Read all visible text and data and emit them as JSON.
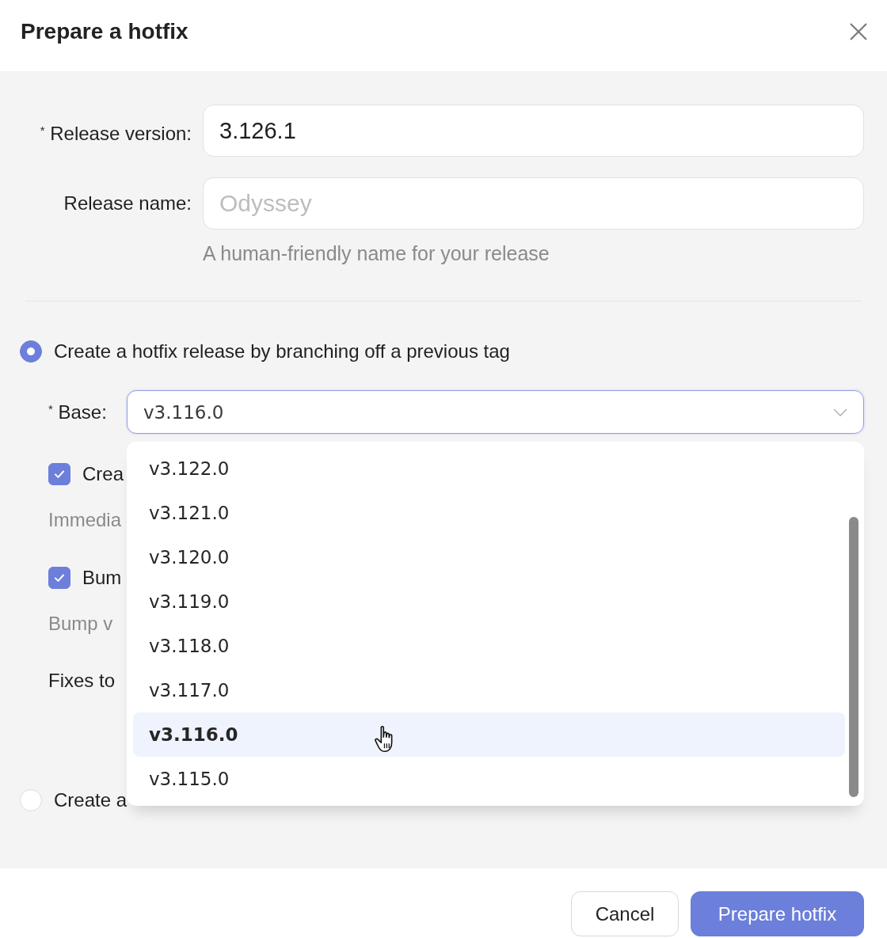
{
  "dialog": {
    "title": "Prepare a hotfix"
  },
  "fields": [
    {
      "label": "$^{*}$ Release version:",
      "value": "3.126.1"
    },
    {
      "label": "Release name:",
      "placeholder": "Odyssey",
      "help": "A human-friendly name for your release"
    }
  ],
  "modes": [
    {
      "label": "Create a hotfix release by branching off a previous tag",
      "selected": true,
      "base": {
        "label": "$^{*}$ Base:",
        "value": "v3.116.0",
        "expanded": true,
        "options": [
          {
            "label": "v3.122.0",
            "selected": false
          },
          {
            "label": "v3.121.0",
            "selected": false
          },
          {
            "label": "v3.120.0",
            "selected": false
          },
          {
            "label": "v3.119.0",
            "selected": false
          },
          {
            "label": "v3.118.0",
            "selected": false
          },
          {
            "label": "v3.117.0",
            "selected": false
          },
          {
            "label": "v3.116.0",
            "selected": true
          },
          {
            "label": "v3.115.0",
            "selected": false
          }
        ]
      },
      "settings": [
        {
          "kind": "checkbox",
          "label": "Crea",
          "checked": true
        },
        {
          "kind": "note",
          "text": "Immedia"
        },
        {
          "kind": "checkbox",
          "label": "Bum",
          "checked": true
        },
        {
          "kind": "note",
          "text": "Bump v"
        },
        {
          "kind": "field",
          "label": "Fixes to"
        }
      ]
    },
    {
      "label": "Create a",
      "selected": false
    }
  ],
  "buttons": [
    {
      "label": "Cancel",
      "kind": "secondary"
    },
    {
      "label": "Prepare hotfix",
      "kind": "primary"
    }
  ]
}
